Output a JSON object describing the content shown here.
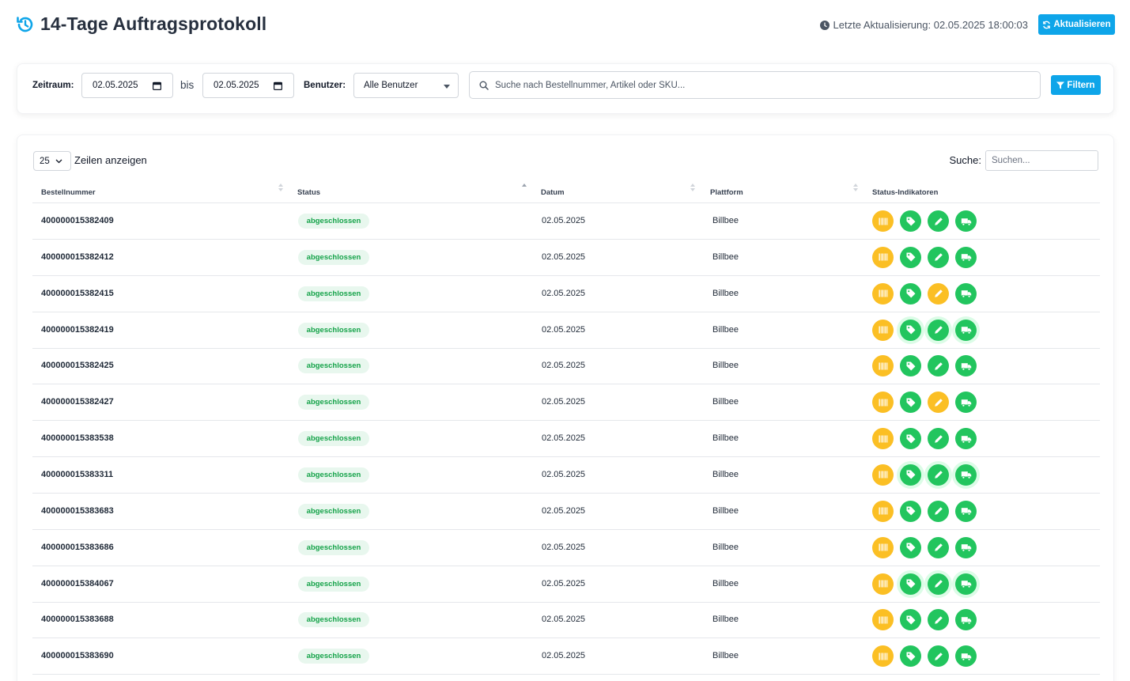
{
  "header": {
    "title": "14-Tage Auftragsprotokoll",
    "last_update_label": "Letzte Aktualisierung: 02.05.2025 18:00:03",
    "refresh_label": "Aktualisieren"
  },
  "filters": {
    "period_label": "Zeitraum:",
    "date_from": "02.05.2025",
    "between": "bis",
    "date_to": "02.05.2025",
    "user_label": "Benutzer:",
    "user_value": "Alle Benutzer",
    "search_placeholder": "Suche nach Bestellnummer, Artikel oder SKU...",
    "filter_label": "Filtern"
  },
  "table": {
    "page_length": "25",
    "page_length_label": "Zeilen anzeigen",
    "search_label": "Suche:",
    "search_placeholder": "Suchen...",
    "columns": [
      "Bestellnummer",
      "Status",
      "Datum",
      "Plattform",
      "Status-Indikatoren"
    ],
    "rows": [
      {
        "id": "400000015382409",
        "status": "abgeschlossen",
        "date": "02.05.2025",
        "platform": "Billbee",
        "ind": [
          "orange",
          "green",
          "green",
          "green"
        ],
        "glow": false
      },
      {
        "id": "400000015382412",
        "status": "abgeschlossen",
        "date": "02.05.2025",
        "platform": "Billbee",
        "ind": [
          "orange",
          "green",
          "green",
          "green"
        ],
        "glow": false
      },
      {
        "id": "400000015382415",
        "status": "abgeschlossen",
        "date": "02.05.2025",
        "platform": "Billbee",
        "ind": [
          "orange",
          "green",
          "orange",
          "green"
        ],
        "glow": false
      },
      {
        "id": "400000015382419",
        "status": "abgeschlossen",
        "date": "02.05.2025",
        "platform": "Billbee",
        "ind": [
          "orange",
          "green",
          "green",
          "green"
        ],
        "glow": true
      },
      {
        "id": "400000015382425",
        "status": "abgeschlossen",
        "date": "02.05.2025",
        "platform": "Billbee",
        "ind": [
          "orange",
          "green",
          "green",
          "green"
        ],
        "glow": false
      },
      {
        "id": "400000015382427",
        "status": "abgeschlossen",
        "date": "02.05.2025",
        "platform": "Billbee",
        "ind": [
          "orange",
          "green",
          "orange",
          "green"
        ],
        "glow": false
      },
      {
        "id": "400000015383538",
        "status": "abgeschlossen",
        "date": "02.05.2025",
        "platform": "Billbee",
        "ind": [
          "orange",
          "green",
          "green",
          "green"
        ],
        "glow": false
      },
      {
        "id": "400000015383311",
        "status": "abgeschlossen",
        "date": "02.05.2025",
        "platform": "Billbee",
        "ind": [
          "orange",
          "green",
          "green",
          "green"
        ],
        "glow": true
      },
      {
        "id": "400000015383683",
        "status": "abgeschlossen",
        "date": "02.05.2025",
        "platform": "Billbee",
        "ind": [
          "orange",
          "green",
          "green",
          "green"
        ],
        "glow": false
      },
      {
        "id": "400000015383686",
        "status": "abgeschlossen",
        "date": "02.05.2025",
        "platform": "Billbee",
        "ind": [
          "orange",
          "green",
          "green",
          "green"
        ],
        "glow": false
      },
      {
        "id": "400000015384067",
        "status": "abgeschlossen",
        "date": "02.05.2025",
        "platform": "Billbee",
        "ind": [
          "orange",
          "green",
          "green",
          "green"
        ],
        "glow": true
      },
      {
        "id": "400000015383688",
        "status": "abgeschlossen",
        "date": "02.05.2025",
        "platform": "Billbee",
        "ind": [
          "orange",
          "green",
          "green",
          "green"
        ],
        "glow": false
      },
      {
        "id": "400000015383690",
        "status": "abgeschlossen",
        "date": "02.05.2025",
        "platform": "Billbee",
        "ind": [
          "orange",
          "green",
          "green",
          "green"
        ],
        "glow": false
      },
      {
        "id": "",
        "status": "",
        "date": "",
        "platform": "",
        "ind": [
          "orange",
          "green",
          "orange",
          "green"
        ],
        "glow": false
      }
    ]
  },
  "indicator_icons": [
    "barcode-icon",
    "tag-icon",
    "pencil-icon",
    "truck-icon"
  ],
  "colors": {
    "accent": "#0ea5e9",
    "success": "#22c55e",
    "warning": "#fbbf24",
    "badge_bg": "#e8f7ee"
  }
}
